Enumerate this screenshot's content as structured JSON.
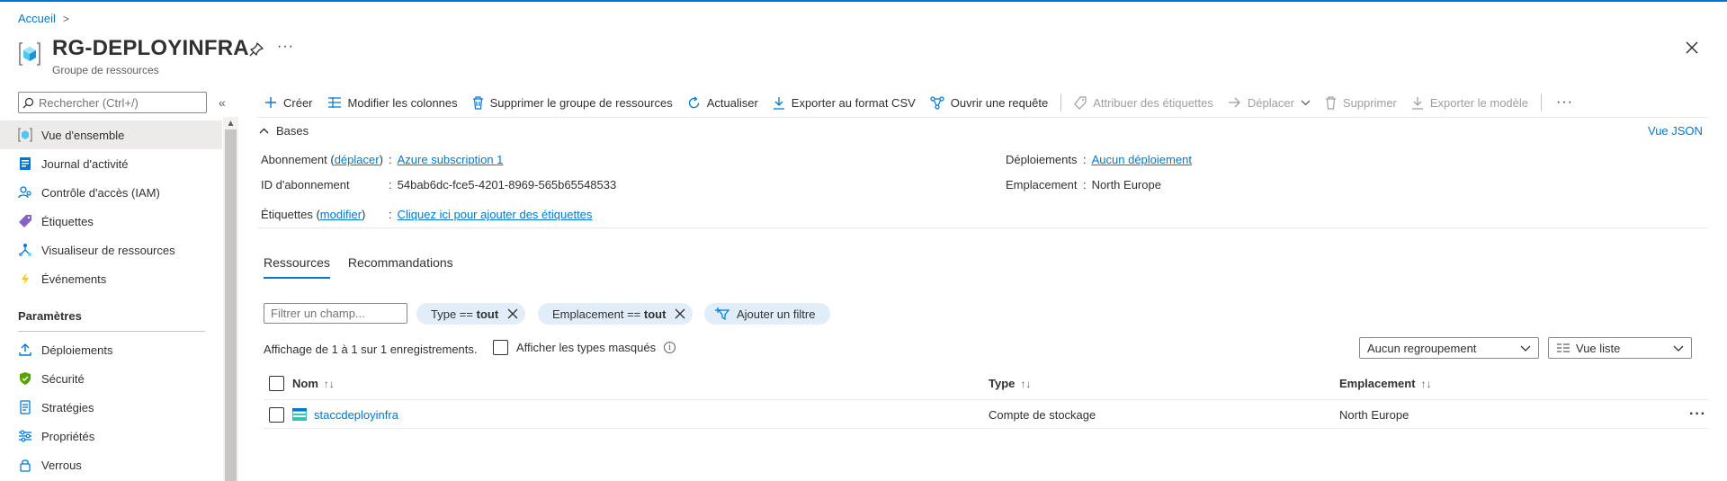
{
  "breadcrumb": {
    "home": "Accueil",
    "separator": ">"
  },
  "header": {
    "title": "RG-DEPLOYINFRA",
    "subtitle": "Groupe de ressources",
    "more": "···"
  },
  "sidebar": {
    "search_placeholder": "Rechercher (Ctrl+/)",
    "collapse": "«",
    "items": [
      {
        "label": "Vue d'ensemble",
        "icon": "resource-group-icon",
        "active": true
      },
      {
        "label": "Journal d'activité",
        "icon": "activity-log-icon"
      },
      {
        "label": "Contrôle d'accès (IAM)",
        "icon": "iam-icon"
      },
      {
        "label": "Étiquettes",
        "icon": "tag-icon"
      },
      {
        "label": "Visualiseur de ressources",
        "icon": "resource-visualizer-icon"
      },
      {
        "label": "Événements",
        "icon": "lightning-icon"
      }
    ],
    "section_title": "Paramètres",
    "settings_items": [
      {
        "label": "Déploiements",
        "icon": "deploy-icon"
      },
      {
        "label": "Sécurité",
        "icon": "shield-icon"
      },
      {
        "label": "Stratégies",
        "icon": "policy-icon"
      },
      {
        "label": "Propriétés",
        "icon": "properties-icon"
      },
      {
        "label": "Verrous",
        "icon": "lock-icon"
      }
    ]
  },
  "toolbar": {
    "create": "Créer",
    "edit_columns": "Modifier les colonnes",
    "delete_group": "Supprimer le groupe de ressources",
    "refresh": "Actualiser",
    "export_csv": "Exporter au format CSV",
    "open_query": "Ouvrir une requête",
    "assign_tags": "Attribuer des étiquettes",
    "move": "Déplacer",
    "delete": "Supprimer",
    "export_template": "Exporter le modèle",
    "more": "···"
  },
  "essentials": {
    "toggle_label": "Bases",
    "json_view": "Vue JSON",
    "subscription_label": "Abonnement",
    "subscription_move": "déplacer",
    "subscription_value": "Azure subscription 1",
    "subscription_id_label": "ID d'abonnement",
    "subscription_id_value": "54bab6dc-fce5-4201-8969-565b65548533",
    "tags_label": "Étiquettes",
    "tags_edit": "modifier",
    "tags_value": "Cliquez ici pour ajouter des étiquettes",
    "deployments_label": "Déploiements",
    "deployments_value": "Aucun déploiement",
    "location_label": "Emplacement",
    "location_value": "North Europe"
  },
  "tabs": [
    {
      "label": "Ressources",
      "active": true
    },
    {
      "label": "Recommandations"
    }
  ],
  "filters": {
    "field_placeholder": "Filtrer un champ...",
    "type_pill_prefix": "Type ==",
    "type_pill_value": "tout",
    "location_pill_prefix": "Emplacement ==",
    "location_pill_value": "tout",
    "add_filter": "Ajouter un filtre"
  },
  "records": {
    "text": "Affichage de 1 à 1 sur 1 enregistrements.",
    "show_hidden": "Afficher les types masqués",
    "grouping": "Aucun regroupement",
    "view": "Vue liste"
  },
  "table": {
    "columns": [
      "Nom",
      "Type",
      "Emplacement"
    ],
    "rows": [
      {
        "name": "staccdeployinfra",
        "type": "Compte de stockage",
        "location": "North Europe"
      }
    ]
  },
  "colors": {
    "accent": "#0078d4",
    "active_bg": "#edebe9",
    "pill_bg": "#e1eef9"
  }
}
